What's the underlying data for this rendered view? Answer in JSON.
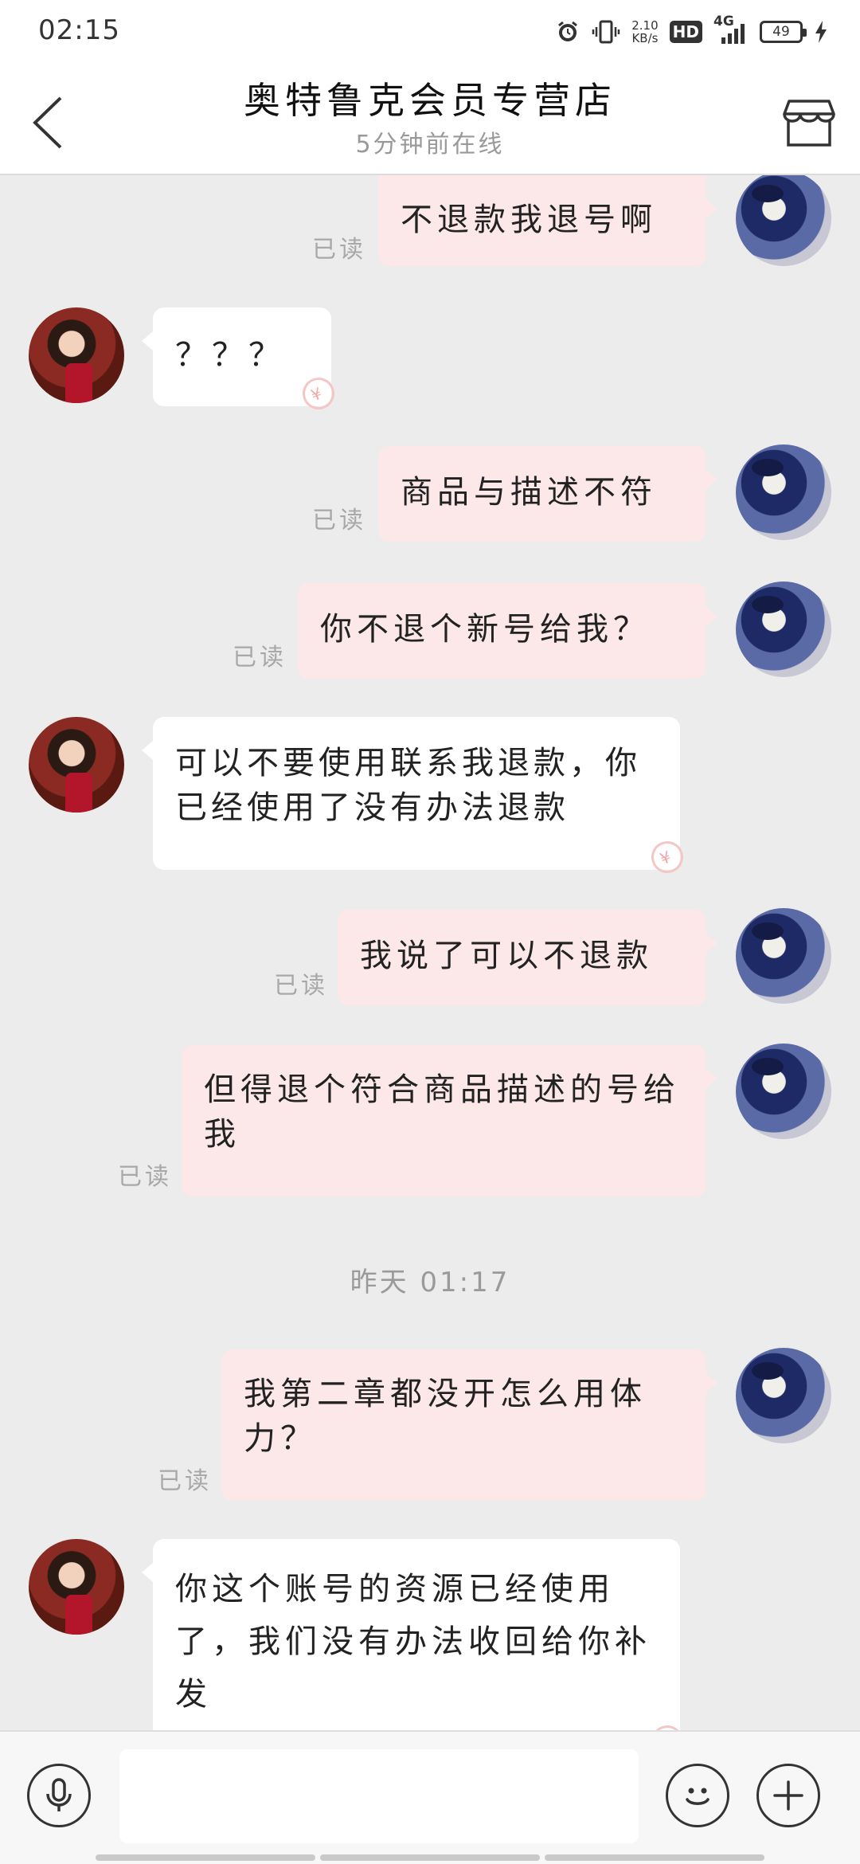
{
  "status_bar": {
    "time": "02:15",
    "net_speed_value": "2.10",
    "net_speed_unit": "KB/s",
    "hd": "HD",
    "network": "4G",
    "battery": "49",
    "icons": [
      "alarm-icon",
      "vibrate-icon",
      "signal-icon",
      "battery-icon",
      "charging-bolt-icon"
    ]
  },
  "header": {
    "title": "奥特鲁克会员专营店",
    "subtitle": "5分钟前在线",
    "back_icon": "chevron-left-icon",
    "store_icon": "store-icon"
  },
  "messages": [
    {
      "side": "sent",
      "text": "不退款我退号啊",
      "read": "已读"
    },
    {
      "side": "recv",
      "text": "？？？"
    },
    {
      "side": "sent",
      "text": "商品与描述不符",
      "read": "已读"
    },
    {
      "side": "sent",
      "text": "你不退个新号给我？",
      "read": "已读"
    },
    {
      "side": "recv",
      "text": "可以不要使用联系我退款，你已经使用了没有办法退款"
    },
    {
      "side": "sent",
      "text": "我说了可以不退款",
      "read": "已读"
    },
    {
      "side": "sent",
      "text": "但得退个符合商品描述的号给我",
      "read": "已读"
    },
    {
      "side": "time",
      "text": "昨天 01:17"
    },
    {
      "side": "sent",
      "text": "我第二章都没开怎么用体力？",
      "read": "已读"
    },
    {
      "side": "recv",
      "text": "你这个账号的资源已经使用了，我们没有办法收回给你补发"
    }
  ],
  "input_bar": {
    "placeholder": "",
    "icons": [
      "microphone-icon",
      "emoji-icon",
      "plus-icon"
    ]
  },
  "colors": {
    "sent_bubble": "#fce8e8",
    "recv_bubble": "#ffffff",
    "background": "#ececec",
    "read_label": "#a8a8a8"
  }
}
